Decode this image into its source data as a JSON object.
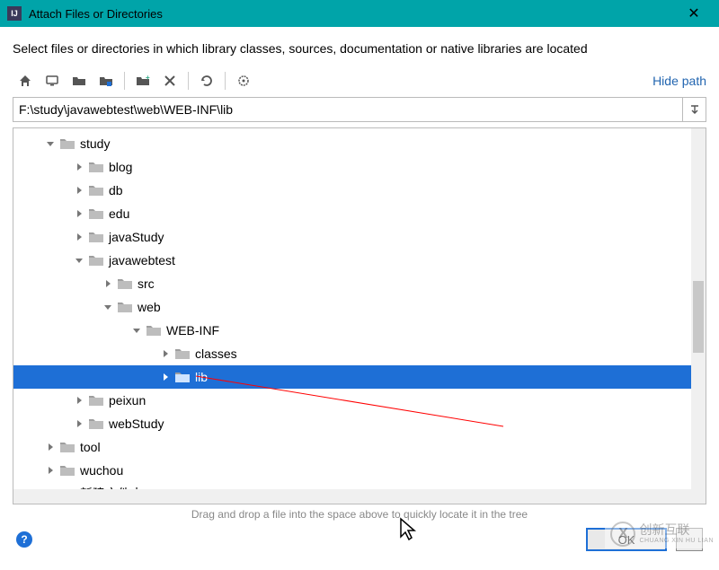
{
  "window": {
    "title": "Attach Files or Directories",
    "instruction": "Select files or directories in which library classes, sources, documentation or native libraries are located"
  },
  "toolbar": {
    "hide_path_label": "Hide path",
    "icons": {
      "home": "home-icon",
      "desktop": "desktop-icon",
      "new_folder": "new-folder-icon",
      "new_folder_alt": "new-folder-alt-icon",
      "new_folder_plus": "new-folder-plus-icon",
      "delete": "delete-icon",
      "refresh": "refresh-icon",
      "show_hidden": "show-hidden-icon"
    }
  },
  "path": {
    "value": "F:\\study\\javawebtest\\web\\WEB-INF\\lib"
  },
  "tree": {
    "nodes": [
      {
        "indent": 2,
        "arrow": "down",
        "label": "study",
        "icon": "grey"
      },
      {
        "indent": 4,
        "arrow": "right",
        "label": "blog",
        "icon": "grey"
      },
      {
        "indent": 4,
        "arrow": "right",
        "label": "db",
        "icon": "grey"
      },
      {
        "indent": 4,
        "arrow": "right",
        "label": "edu",
        "icon": "grey"
      },
      {
        "indent": 4,
        "arrow": "right",
        "label": "javaStudy",
        "icon": "grey"
      },
      {
        "indent": 4,
        "arrow": "down",
        "label": "javawebtest",
        "icon": "grey"
      },
      {
        "indent": 6,
        "arrow": "right",
        "label": "src",
        "icon": "grey"
      },
      {
        "indent": 6,
        "arrow": "down",
        "label": "web",
        "icon": "grey"
      },
      {
        "indent": 8,
        "arrow": "down",
        "label": "WEB-INF",
        "icon": "grey"
      },
      {
        "indent": 10,
        "arrow": "right",
        "label": "classes",
        "icon": "grey"
      },
      {
        "indent": 10,
        "arrow": "right",
        "label": "lib",
        "icon": "grey",
        "selected": true
      },
      {
        "indent": 4,
        "arrow": "right",
        "label": "peixun",
        "icon": "grey"
      },
      {
        "indent": 4,
        "arrow": "right",
        "label": "webStudy",
        "icon": "grey"
      },
      {
        "indent": 2,
        "arrow": "right",
        "label": "tool",
        "icon": "grey"
      },
      {
        "indent": 2,
        "arrow": "right",
        "label": "wuchou",
        "icon": "grey"
      },
      {
        "indent": 2,
        "arrow": "right",
        "label": "新建文件夹",
        "icon": "grey"
      }
    ]
  },
  "drop_hint": "Drag and drop a file into the space above to quickly locate it in the tree",
  "footer": {
    "help": "?",
    "ok": "OK",
    "cancel": ""
  },
  "watermark": {
    "brand": "创新互联",
    "sub": "CHUANG XIN HU LIAN"
  },
  "colors": {
    "accent": "#1e6fd6",
    "titlebar": "#00a4a9"
  }
}
